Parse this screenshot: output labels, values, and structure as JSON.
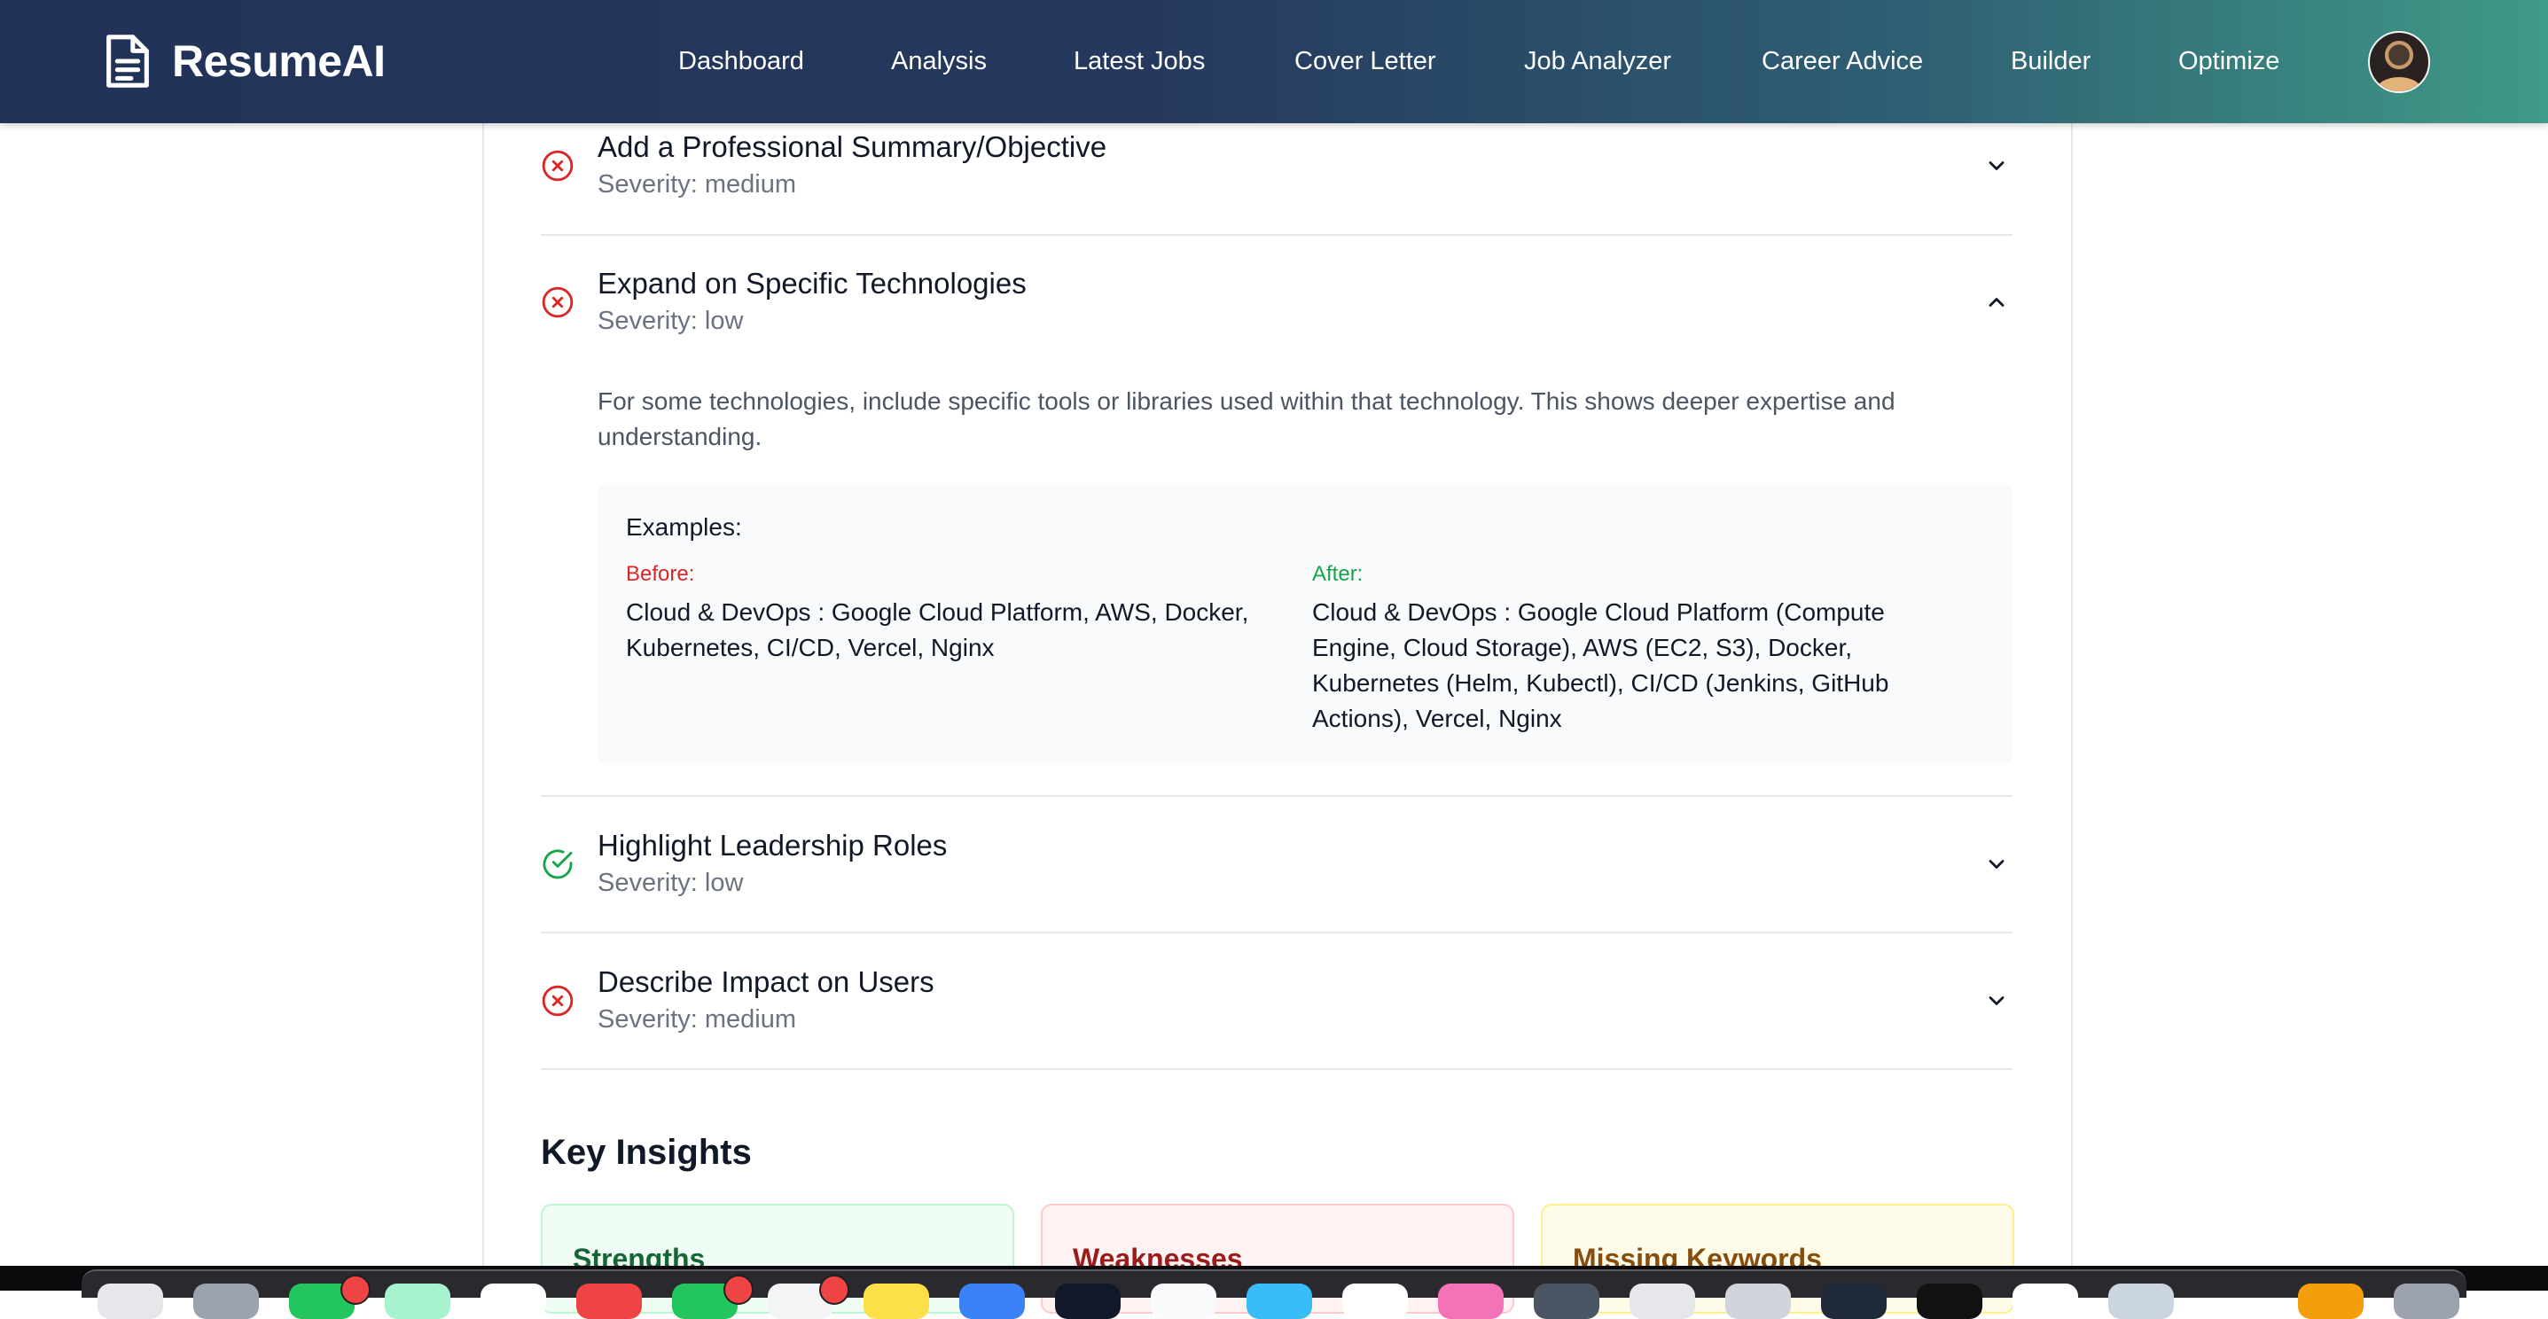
{
  "app": {
    "brand_name": "ResumeAI",
    "brand_icon": "document-icon"
  },
  "nav": {
    "links": [
      "Dashboard",
      "Analysis",
      "Latest Jobs",
      "Cover Letter",
      "Job Analyzer",
      "Career Advice",
      "Builder",
      "Optimize"
    ],
    "avatar": "user-avatar"
  },
  "suggestions": [
    {
      "title": "Add a Professional Summary/Objective",
      "severity": "Severity: medium",
      "status_icon": "x-circle-icon",
      "expanded": false
    },
    {
      "title": "Expand on Specific Technologies",
      "severity": "Severity: low",
      "status_icon": "x-circle-icon",
      "expanded": true,
      "description": "For some technologies, include specific tools or libraries used within that technology. This shows deeper expertise and understanding.",
      "examples_heading": "Examples:",
      "before_label": "Before:",
      "before_text": "Cloud & DevOps : Google Cloud Platform, AWS, Docker, Kubernetes, CI/CD, Vercel, Nginx",
      "after_label": "After:",
      "after_text": "Cloud & DevOps : Google Cloud Platform (Compute Engine, Cloud Storage), AWS (EC2, S3), Docker, Kubernetes (Helm, Kubectl), CI/CD (Jenkins, GitHub Actions), Vercel, Nginx"
    },
    {
      "title": "Highlight Leadership Roles",
      "severity": "Severity: low",
      "status_icon": "check-circle-icon",
      "expanded": false
    },
    {
      "title": "Describe Impact on Users",
      "severity": "Severity: medium",
      "status_icon": "x-circle-icon",
      "expanded": false
    }
  ],
  "key_insights": {
    "title": "Key Insights",
    "cards": [
      "Strengths",
      "Weaknesses",
      "Missing Keywords"
    ]
  },
  "colors": {
    "nav_gradient_start": "#223258",
    "nav_gradient_end": "#3f9a87",
    "error_red": "#dc2626",
    "success_green": "#16a34a"
  }
}
